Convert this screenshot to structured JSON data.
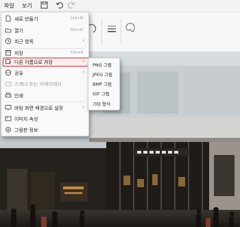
{
  "menubar": {
    "file": "파일",
    "view": "보기"
  },
  "file_menu": {
    "items": [
      {
        "label": "새로 만들기",
        "shortcut": "Ctrl+N"
      },
      {
        "label": "열기",
        "shortcut": "Ctrl+O"
      },
      {
        "label": "최근 항목",
        "shortcut": ""
      },
      {
        "label": "저장",
        "shortcut": "Ctrl+S"
      },
      {
        "label": "다른 이름으로 저장",
        "shortcut": ""
      },
      {
        "label": "공유",
        "shortcut": ""
      },
      {
        "label": "스캐너 또는 카메라에서",
        "shortcut": ""
      },
      {
        "label": "인쇄",
        "shortcut": ""
      },
      {
        "label": "바탕 화면 배경으로 설정",
        "shortcut": ""
      },
      {
        "label": "이미지 속성",
        "shortcut": ""
      },
      {
        "label": "그림판 정보",
        "shortcut": ""
      }
    ]
  },
  "save_as_submenu": {
    "items": [
      {
        "label": "PNG 그림"
      },
      {
        "label": "JPEG 그림"
      },
      {
        "label": "BMP 그림"
      },
      {
        "label": "GIF 그림"
      },
      {
        "label": "기타 형식"
      }
    ]
  },
  "colors": {
    "highlight_border": "#d32f2f",
    "menu_bg": "#f9f9f9"
  }
}
